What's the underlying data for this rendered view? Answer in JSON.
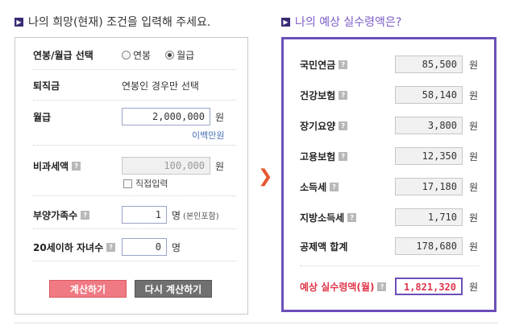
{
  "left_section": {
    "title": "나의 희망(현재) 조건을 입력해 주세요.",
    "salary_type": {
      "label": "연봉/월급 선택",
      "options": [
        "연봉",
        "월급"
      ],
      "selected": "월급"
    },
    "severance": {
      "label": "퇴직금",
      "note": "연봉인 경우만 선택"
    },
    "monthly_pay": {
      "label": "월급",
      "value": "2,000,000",
      "unit": "원",
      "hint": "이백만원"
    },
    "non_taxable": {
      "label": "비과세액",
      "value": "100,000",
      "unit": "원",
      "checkbox_label": "직접입력"
    },
    "dependents": {
      "label": "부양가족수",
      "value": "1",
      "unit": "명",
      "note": "(본인포함)"
    },
    "children": {
      "label": "20세이하 자녀수",
      "value": "0",
      "unit": "명"
    },
    "buttons": {
      "calculate": "계산하기",
      "recalculate": "다시 계산하기"
    }
  },
  "right_section": {
    "title": "나의 예상 실수령액은?",
    "items": [
      {
        "label": "국민연금",
        "value": "85,500",
        "unit": "원",
        "help": true
      },
      {
        "label": "건강보험",
        "value": "58,140",
        "unit": "원",
        "help": true
      },
      {
        "label": "장기요양",
        "value": "3,800",
        "unit": "원",
        "help": true
      },
      {
        "label": "고용보험",
        "value": "12,350",
        "unit": "원",
        "help": true
      },
      {
        "label": "소득세",
        "value": "17,180",
        "unit": "원",
        "help": true
      },
      {
        "label": "지방소득세",
        "value": "1,710",
        "unit": "원",
        "help": true
      },
      {
        "label": "공제액 합계",
        "value": "178,680",
        "unit": "원",
        "help": false
      }
    ],
    "total": {
      "label": "예상 실수령액(월)",
      "value": "1,821,320",
      "unit": "원"
    }
  },
  "icons": {
    "help": "?",
    "section_marker": "▶",
    "arrow": "❯"
  },
  "colors": {
    "accent_purple": "#6b4fb8",
    "total_red": "#e0364a",
    "calc_button": "#f07a84",
    "arrow": "#e4572e"
  }
}
